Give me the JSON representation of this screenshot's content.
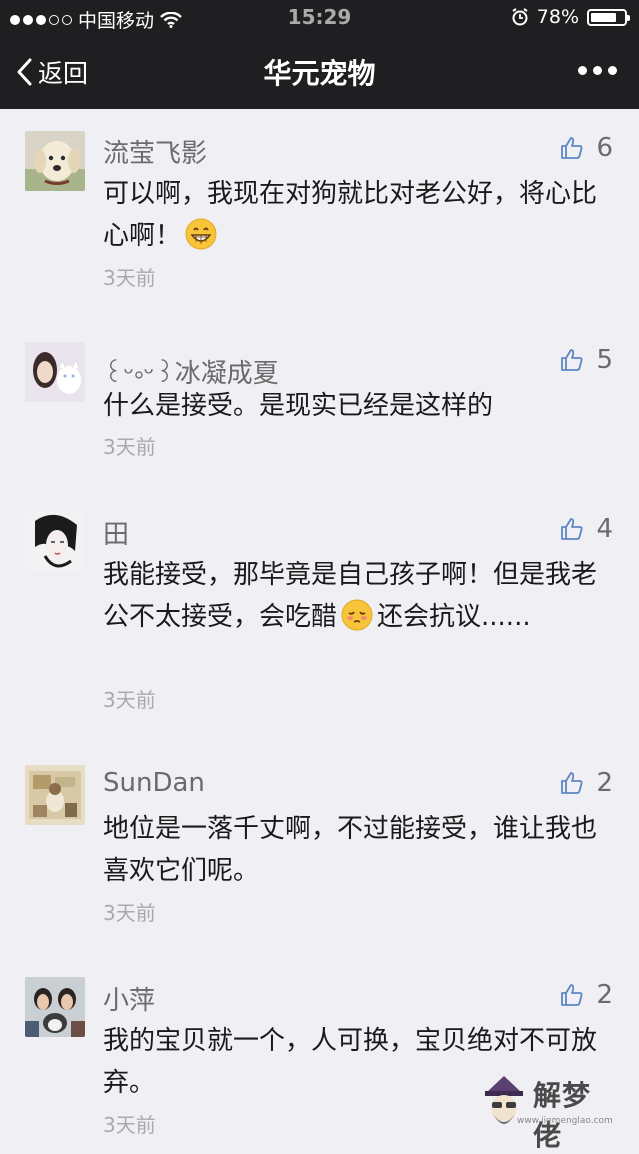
{
  "status_bar": {
    "carrier": "中国移动",
    "time": "15:29",
    "battery_percent": "78%",
    "battery_level": 0.78
  },
  "nav": {
    "back_label": "返回",
    "title": "华元宠物"
  },
  "comments": [
    {
      "nickname": "流莹飞影",
      "likes": "6",
      "text": "可以啊，我现在对狗就比对老公好，将心比心啊！",
      "time": "3天前"
    },
    {
      "nickname": "꒰ᵕ༚ᵕ꒱冰凝成夏",
      "likes": "5",
      "text": "什么是接受。是现实已经是这样的",
      "time": "3天前"
    },
    {
      "nickname": "田",
      "likes": "4",
      "text_before_emoji": "我能接受，那毕竟是自己孩子啊！但是我老公不太接受，会吃醋",
      "text_after_emoji": "还会抗议......",
      "time": "3天前"
    },
    {
      "nickname": "SunDan",
      "likes": "2",
      "text": "地位是一落千丈啊，不过能接受，谁让我也喜欢它们呢。",
      "time": "3天前"
    },
    {
      "nickname": "小萍",
      "likes": "2",
      "text": "我的宝贝就一个，人可换，宝贝绝对不可放弃。",
      "time": "3天前"
    }
  ],
  "watermark": {
    "brand": "解梦佬",
    "url": "www.jiemenglao.com"
  }
}
